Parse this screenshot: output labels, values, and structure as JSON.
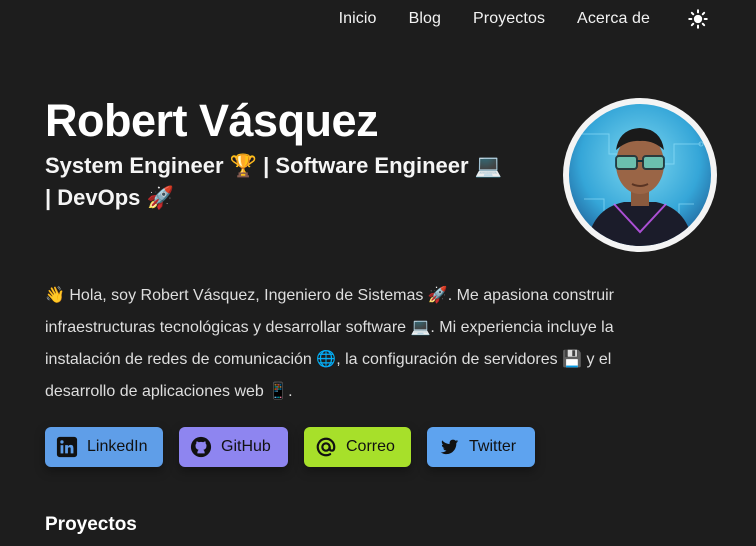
{
  "nav": {
    "items": [
      "Inicio",
      "Blog",
      "Proyectos",
      "Acerca de"
    ],
    "theme_icon": "sun-icon"
  },
  "header": {
    "name": "Robert Vásquez",
    "subtitle_line1": "System Engineer 🏆 | Software Engineer 💻",
    "subtitle_line2": "| DevOps 🚀"
  },
  "bio": {
    "line1": "👋 Hola, soy Robert Vásquez, Ingeniero de Sistemas 🚀. Me apasiona construir",
    "line2": "infraestructuras tecnológicas y desarrollar software 💻. Mi experiencia incluye la",
    "line3": "instalación de redes de comunicación 🌐, la configuración de servidores 💾 y el",
    "line4": "desarrollo de aplicaciones web 📱."
  },
  "socials": [
    {
      "label": "LinkedIn",
      "icon": "linkedin-icon",
      "color": "#5f9ee8"
    },
    {
      "label": "GitHub",
      "icon": "github-icon",
      "color": "#8e85f0"
    },
    {
      "label": "Correo",
      "icon": "at-icon",
      "color": "#a7e02a"
    },
    {
      "label": "Twitter",
      "icon": "twitter-icon",
      "color": "#5ea3ef"
    }
  ],
  "sections": {
    "projects_title": "Proyectos"
  },
  "colors": {
    "background": "#1d1d1d",
    "text": "#ffffff"
  }
}
